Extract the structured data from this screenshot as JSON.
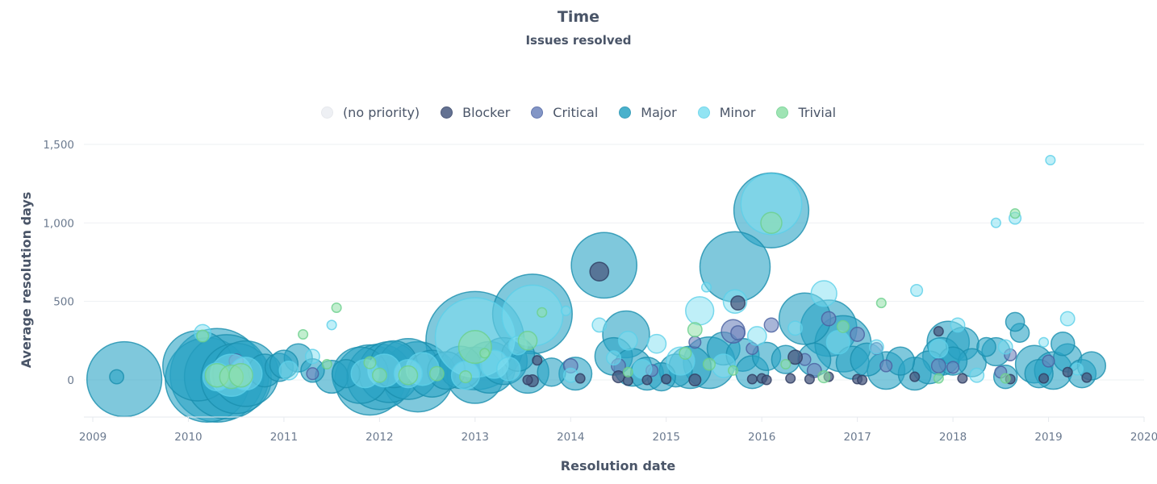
{
  "title": "Time",
  "subtitle": "Issues resolved",
  "legend": [
    {
      "label": "(no priority)",
      "color": "#eef0f4",
      "stroke": "#e6e8ec"
    },
    {
      "label": "Blocker",
      "color": "#4a5a80",
      "stroke": "#2f3d62"
    },
    {
      "label": "Critical",
      "color": "#6e84bd",
      "stroke": "#4a60a0"
    },
    {
      "label": "Major",
      "color": "#2aa4c4",
      "stroke": "#1a8fae"
    },
    {
      "label": "Minor",
      "color": "#7fe0f2",
      "stroke": "#5dd0e8"
    },
    {
      "label": "Trivial",
      "color": "#8fe0a8",
      "stroke": "#6cd08c"
    }
  ],
  "chart_data": {
    "type": "scatter",
    "subtype": "bubble",
    "title": "Time",
    "subtitle": "Issues resolved",
    "xlabel": "Resolution date",
    "ylabel": "Average resolution days",
    "xlim": [
      2009,
      2020
    ],
    "ylim": [
      -240,
      1500
    ],
    "x_ticks": [
      "2009",
      "2010",
      "2011",
      "2012",
      "2013",
      "2014",
      "2015",
      "2016",
      "2017",
      "2018",
      "2019",
      "2020"
    ],
    "y_ticks": [
      {
        "value": 0,
        "label": "0"
      },
      {
        "value": 500,
        "label": "500"
      },
      {
        "value": 1000,
        "label": "1,000"
      },
      {
        "value": 1500,
        "label": "1,500"
      }
    ],
    "grid": "horizontal",
    "legend_position": "top-center",
    "size_meaning": "number of issues resolved (relative bubble size)",
    "series": [
      {
        "name": "(no priority)",
        "points": []
      },
      {
        "name": "Blocker",
        "points": [
          [
            2013.55,
            0,
            4
          ],
          [
            2013.6,
            -5,
            5
          ],
          [
            2014.1,
            10,
            4
          ],
          [
            2014.5,
            20,
            5
          ],
          [
            2014.6,
            -5,
            4
          ],
          [
            2014.8,
            0,
            4
          ],
          [
            2015.0,
            5,
            4
          ],
          [
            2015.3,
            0,
            5
          ],
          [
            2015.9,
            5,
            4
          ],
          [
            2016.0,
            10,
            4
          ],
          [
            2016.05,
            0,
            4
          ],
          [
            2016.3,
            10,
            4
          ],
          [
            2016.5,
            5,
            4
          ],
          [
            2016.7,
            20,
            4
          ],
          [
            2017.0,
            5,
            4
          ],
          [
            2017.05,
            0,
            4
          ],
          [
            2017.6,
            20,
            4
          ],
          [
            2017.85,
            310,
            4
          ],
          [
            2018.1,
            10,
            4
          ],
          [
            2018.6,
            5,
            4
          ],
          [
            2018.95,
            10,
            4
          ],
          [
            2019.2,
            50,
            4
          ],
          [
            2019.4,
            15,
            4
          ],
          [
            2015.75,
            490,
            6
          ],
          [
            2014.3,
            690,
            8
          ],
          [
            2016.35,
            145,
            6
          ],
          [
            2013.65,
            125,
            4
          ]
        ]
      },
      {
        "name": "Critical",
        "points": [
          [
            2010.5,
            120,
            6
          ],
          [
            2011.3,
            40,
            5
          ],
          [
            2014.0,
            90,
            6
          ],
          [
            2014.5,
            90,
            6
          ],
          [
            2015.3,
            240,
            5
          ],
          [
            2015.7,
            310,
            10
          ],
          [
            2015.75,
            300,
            6
          ],
          [
            2016.1,
            350,
            6
          ],
          [
            2016.45,
            130,
            5
          ],
          [
            2016.55,
            60,
            6
          ],
          [
            2016.7,
            390,
            6
          ],
          [
            2017.0,
            290,
            6
          ],
          [
            2017.2,
            200,
            5
          ],
          [
            2017.3,
            90,
            5
          ],
          [
            2018.6,
            160,
            5
          ],
          [
            2018.0,
            80,
            5
          ],
          [
            2018.5,
            50,
            5
          ],
          [
            2019.0,
            120,
            5
          ],
          [
            2017.85,
            90,
            6
          ],
          [
            2015.9,
            200,
            5
          ],
          [
            2014.85,
            60,
            5
          ]
        ]
      },
      {
        "name": "Major",
        "points": [
          [
            2009.25,
            20,
            6
          ],
          [
            2009.33,
            5,
            32
          ],
          [
            2010.1,
            90,
            30
          ],
          [
            2010.2,
            0,
            36
          ],
          [
            2010.3,
            30,
            40
          ],
          [
            2010.4,
            20,
            36
          ],
          [
            2010.5,
            10,
            30
          ],
          [
            2010.6,
            40,
            28
          ],
          [
            2010.8,
            60,
            14
          ],
          [
            2010.95,
            80,
            12
          ],
          [
            2011.15,
            140,
            12
          ],
          [
            2011.3,
            60,
            10
          ],
          [
            2011.5,
            20,
            14
          ],
          [
            2011.65,
            40,
            12
          ],
          [
            2011.8,
            30,
            24
          ],
          [
            2011.9,
            0,
            30
          ],
          [
            2012.0,
            20,
            28
          ],
          [
            2012.1,
            50,
            26
          ],
          [
            2012.15,
            100,
            20
          ],
          [
            2012.3,
            70,
            26
          ],
          [
            2012.4,
            20,
            30
          ],
          [
            2012.55,
            40,
            20
          ],
          [
            2012.7,
            60,
            16
          ],
          [
            2012.85,
            80,
            18
          ],
          [
            2013.0,
            250,
            42
          ],
          [
            2013.0,
            30,
            24
          ],
          [
            2013.15,
            80,
            22
          ],
          [
            2013.3,
            120,
            20
          ],
          [
            2013.45,
            160,
            14
          ],
          [
            2013.6,
            420,
            34
          ],
          [
            2013.55,
            50,
            18
          ],
          [
            2013.8,
            50,
            12
          ],
          [
            2014.05,
            40,
            14
          ],
          [
            2014.35,
            730,
            28
          ],
          [
            2014.45,
            150,
            16
          ],
          [
            2014.58,
            290,
            20
          ],
          [
            2014.65,
            80,
            16
          ],
          [
            2014.8,
            40,
            14
          ],
          [
            2014.95,
            20,
            12
          ],
          [
            2015.1,
            60,
            14
          ],
          [
            2015.25,
            80,
            18
          ],
          [
            2015.45,
            110,
            22
          ],
          [
            2015.6,
            200,
            14
          ],
          [
            2015.72,
            720,
            30
          ],
          [
            2015.8,
            160,
            14
          ],
          [
            2016.05,
            150,
            12
          ],
          [
            2016.1,
            1080,
            32
          ],
          [
            2016.25,
            130,
            12
          ],
          [
            2016.45,
            390,
            22
          ],
          [
            2016.55,
            130,
            14
          ],
          [
            2016.7,
            330,
            24
          ],
          [
            2016.85,
            230,
            24
          ],
          [
            2016.95,
            110,
            14
          ],
          [
            2017.1,
            130,
            14
          ],
          [
            2017.3,
            60,
            16
          ],
          [
            2017.45,
            120,
            12
          ],
          [
            2017.6,
            40,
            14
          ],
          [
            2017.75,
            80,
            14
          ],
          [
            2017.88,
            150,
            16
          ],
          [
            2017.95,
            240,
            18
          ],
          [
            2018.1,
            230,
            14
          ],
          [
            2018.2,
            110,
            12
          ],
          [
            2018.35,
            210,
            8
          ],
          [
            2018.45,
            180,
            12
          ],
          [
            2018.55,
            20,
            10
          ],
          [
            2018.7,
            300,
            8
          ],
          [
            2018.65,
            370,
            8
          ],
          [
            2018.85,
            100,
            16
          ],
          [
            2018.9,
            40,
            12
          ],
          [
            2019.05,
            60,
            16
          ],
          [
            2019.15,
            230,
            10
          ],
          [
            2019.2,
            140,
            12
          ],
          [
            2019.35,
            40,
            12
          ],
          [
            2019.45,
            90,
            12
          ],
          [
            2018.0,
            120,
            12
          ],
          [
            2015.9,
            50,
            14
          ],
          [
            2011.0,
            100,
            12
          ]
        ]
      },
      {
        "name": "Minor",
        "points": [
          [
            2010.15,
            300,
            7
          ],
          [
            2010.45,
            30,
            18
          ],
          [
            2010.6,
            40,
            14
          ],
          [
            2011.05,
            60,
            8
          ],
          [
            2011.3,
            150,
            6
          ],
          [
            2011.5,
            350,
            4
          ],
          [
            2011.85,
            40,
            12
          ],
          [
            2012.05,
            60,
            14
          ],
          [
            2012.45,
            70,
            14
          ],
          [
            2012.9,
            30,
            12
          ],
          [
            2013.0,
            270,
            34
          ],
          [
            2013.2,
            100,
            12
          ],
          [
            2013.35,
            70,
            10
          ],
          [
            2013.45,
            220,
            8
          ],
          [
            2013.6,
            410,
            26
          ],
          [
            2013.95,
            440,
            4
          ],
          [
            2014.3,
            350,
            6
          ],
          [
            2014.45,
            140,
            6
          ],
          [
            2014.6,
            250,
            8
          ],
          [
            2014.75,
            70,
            8
          ],
          [
            2014.9,
            230,
            8
          ],
          [
            2015.15,
            120,
            12
          ],
          [
            2015.35,
            440,
            12
          ],
          [
            2015.42,
            590,
            4
          ],
          [
            2015.6,
            90,
            10
          ],
          [
            2015.72,
            500,
            10
          ],
          [
            2015.95,
            280,
            8
          ],
          [
            2016.1,
            1120,
            26
          ],
          [
            2016.35,
            330,
            6
          ],
          [
            2016.65,
            550,
            11
          ],
          [
            2016.8,
            240,
            10
          ],
          [
            2017.2,
            210,
            6
          ],
          [
            2017.62,
            570,
            5
          ],
          [
            2017.85,
            200,
            8
          ],
          [
            2018.05,
            350,
            6
          ],
          [
            2018.25,
            30,
            6
          ],
          [
            2018.45,
            1000,
            4
          ],
          [
            2018.55,
            210,
            6
          ],
          [
            2018.65,
            1030,
            5
          ],
          [
            2019.02,
            1400,
            4
          ],
          [
            2019.2,
            390,
            6
          ],
          [
            2018.95,
            240,
            4
          ],
          [
            2019.3,
            70,
            5
          ],
          [
            2012.3,
            40,
            12
          ],
          [
            2010.3,
            20,
            12
          ],
          [
            2014.0,
            30,
            6
          ]
        ]
      },
      {
        "name": "Trivial",
        "points": [
          [
            2010.15,
            280,
            5
          ],
          [
            2010.3,
            30,
            10
          ],
          [
            2010.45,
            20,
            10
          ],
          [
            2010.55,
            30,
            10
          ],
          [
            2011.2,
            290,
            4
          ],
          [
            2011.55,
            460,
            4
          ],
          [
            2011.45,
            100,
            4
          ],
          [
            2012.0,
            30,
            6
          ],
          [
            2012.3,
            30,
            8
          ],
          [
            2012.6,
            40,
            6
          ],
          [
            2012.9,
            20,
            5
          ],
          [
            2013.0,
            210,
            14
          ],
          [
            2013.1,
            170,
            4
          ],
          [
            2013.55,
            250,
            8
          ],
          [
            2013.7,
            430,
            4
          ],
          [
            2014.6,
            50,
            4
          ],
          [
            2015.3,
            320,
            6
          ],
          [
            2015.45,
            100,
            5
          ],
          [
            2015.7,
            60,
            4
          ],
          [
            2016.1,
            1000,
            9
          ],
          [
            2016.25,
            100,
            4
          ],
          [
            2016.85,
            340,
            5
          ],
          [
            2017.25,
            490,
            4
          ],
          [
            2016.65,
            20,
            5
          ],
          [
            2017.85,
            10,
            4
          ],
          [
            2018.55,
            10,
            4
          ],
          [
            2018.65,
            1060,
            4
          ],
          [
            2015.2,
            170,
            5
          ],
          [
            2011.9,
            110,
            5
          ]
        ]
      }
    ]
  },
  "axes": {
    "xlabel": "Resolution date",
    "ylabel": "Average resolution days"
  }
}
